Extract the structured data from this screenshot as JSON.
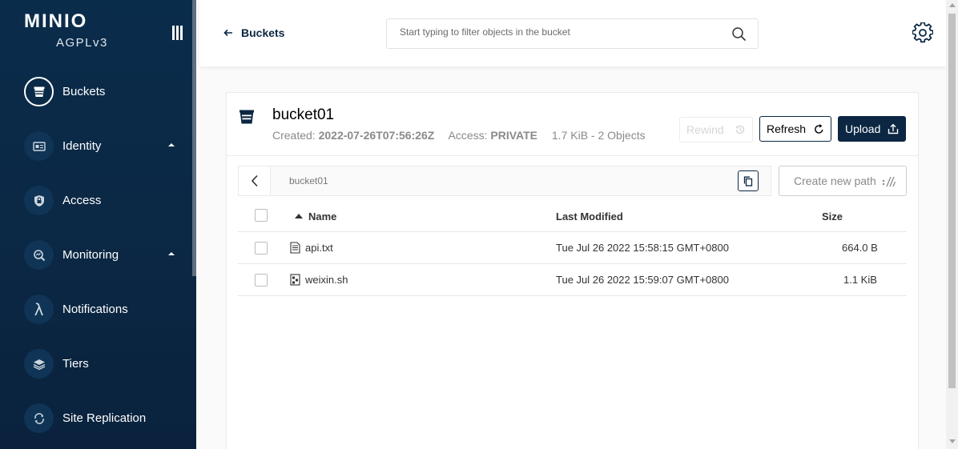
{
  "brand": {
    "name": "MINIO",
    "license": "AGPLv3"
  },
  "sidebar": {
    "items": [
      {
        "label": "Buckets",
        "icon": "bucket-icon",
        "active": true,
        "expandable": false
      },
      {
        "label": "Identity",
        "icon": "identity-card-icon",
        "active": false,
        "expandable": true
      },
      {
        "label": "Access",
        "icon": "lock-shield-icon",
        "active": false,
        "expandable": false
      },
      {
        "label": "Monitoring",
        "icon": "monitoring-search-icon",
        "active": false,
        "expandable": true
      },
      {
        "label": "Notifications",
        "icon": "lambda-icon",
        "active": false,
        "expandable": false
      },
      {
        "label": "Tiers",
        "icon": "layers-icon",
        "active": false,
        "expandable": false
      },
      {
        "label": "Site Replication",
        "icon": "replication-icon",
        "active": false,
        "expandable": false
      }
    ]
  },
  "header": {
    "back_label": "Buckets",
    "search_placeholder": "Start typing to filter objects in the bucket"
  },
  "bucket": {
    "name": "bucket01",
    "created_label": "Created:",
    "created_value": "2022-07-26T07:56:26Z",
    "access_label": "Access:",
    "access_value": "PRIVATE",
    "summary": "1.7 KiB - 2 Objects"
  },
  "actions": {
    "rewind": "Rewind",
    "refresh": "Refresh",
    "upload": "Upload",
    "create_path": "Create new path"
  },
  "breadcrumb": {
    "path": "bucket01"
  },
  "table": {
    "columns": {
      "name": "Name",
      "modified": "Last Modified",
      "size": "Size"
    },
    "sort": {
      "column": "Name",
      "direction": "ascending"
    },
    "rows": [
      {
        "name": "api.txt",
        "type": "text-file-icon",
        "modified": "Tue Jul 26 2022 15:58:15 GMT+0800",
        "size": "664.0 B"
      },
      {
        "name": "weixin.sh",
        "type": "script-file-icon",
        "modified": "Tue Jul 26 2022 15:59:07 GMT+0800",
        "size": "1.1 KiB"
      }
    ]
  },
  "colors": {
    "brand_dark": "#0b2743",
    "sidebar_bg": "#0a2c4b",
    "muted": "#8a8a8a"
  }
}
